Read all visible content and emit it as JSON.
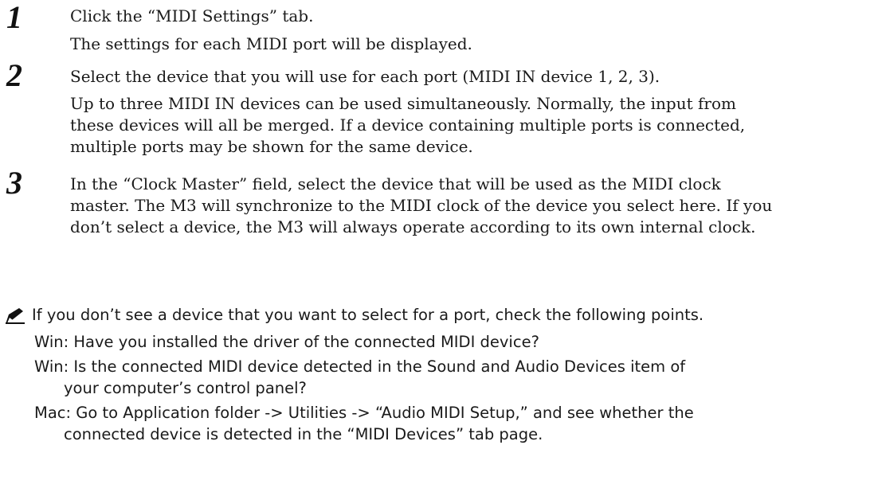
{
  "steps": [
    {
      "number": "1",
      "lines": [
        "Click the “MIDI Settings” tab.",
        "The settings for each MIDI port will be displayed."
      ]
    },
    {
      "number": "2",
      "lines": [
        "Select the device that you will use for each port (MIDI IN device 1, 2, 3).",
        "Up to three MIDI IN devices can be used simultaneously. Normally, the input from",
        "these devices will all be merged. If a device containing multiple ports is connected,",
        "multiple ports may be shown for the same device."
      ]
    },
    {
      "number": "3",
      "lines": [
        "In the “Clock Master” field, select the device that will be used as the MIDI clock",
        "master. The M3 will synchronize to the MIDI clock of the device you select here. If you",
        "don’t select a device, the M3 will always operate according to its own internal clock."
      ]
    }
  ],
  "note": {
    "icon": "caution-pencil-icon",
    "intro": "If you don’t see a device that you want to select for a port, check the following points.",
    "items": [
      "Win:  Have you installed the driver of the connected MIDI device?",
      "Win:  Is the connected MIDI device detected in the Sound and Audio Devices item of",
      "your computer’s control panel?",
      "Mac:  Go to Application folder -> Utilities -> “Audio MIDI Setup,” and see whether the",
      "connected device is detected in the “MIDI Devices” tab page."
    ]
  }
}
